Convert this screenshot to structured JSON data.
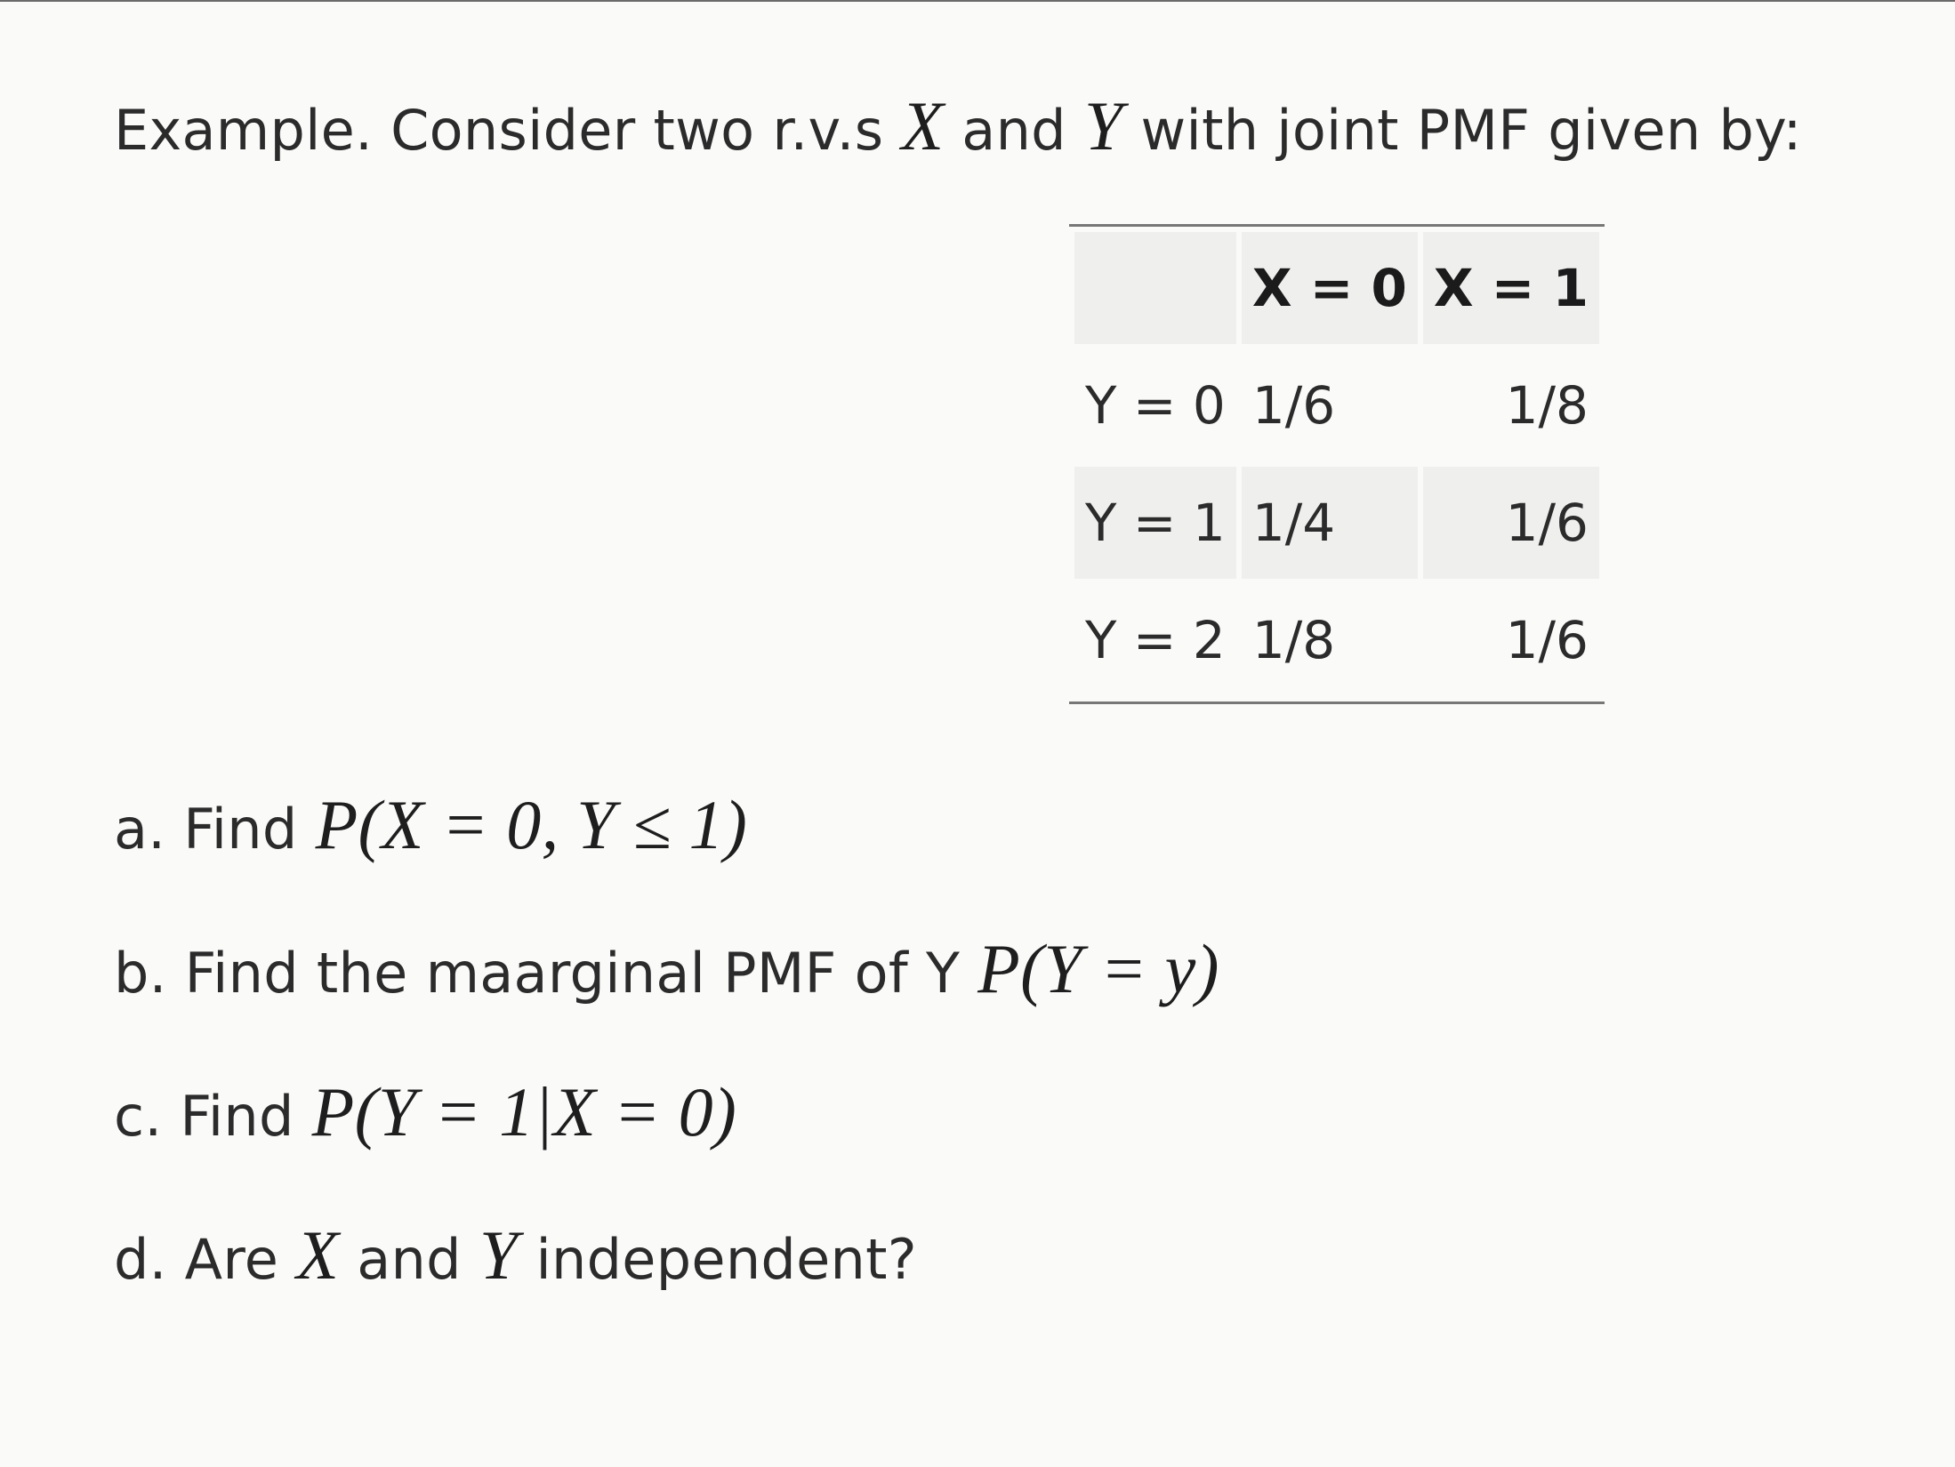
{
  "intro": {
    "prefix": "Example. Consider two r.v.s",
    "var_x": "X",
    "and": "and",
    "var_y": "Y",
    "suffix": "with joint PMF given by:"
  },
  "table": {
    "header": [
      "",
      "X = 0",
      "X = 1"
    ],
    "rows": [
      [
        "Y = 0",
        "1/6",
        "1/8"
      ],
      [
        "Y = 1",
        "1/4",
        "1/6"
      ],
      [
        "Y = 2",
        "1/8",
        "1/6"
      ]
    ]
  },
  "questions": {
    "a": {
      "text": "a. Find",
      "math": "P(X = 0, Y ≤ 1)"
    },
    "b": {
      "text": "b. Find the maarginal PMF of Y",
      "math": "P(Y = y)"
    },
    "c": {
      "text": "c. Find",
      "math": "P(Y = 1|X = 0)"
    },
    "d": {
      "prefix": "d. Are",
      "var_x": "X",
      "and": "and",
      "var_y": "Y",
      "suffix": "independent?"
    }
  }
}
